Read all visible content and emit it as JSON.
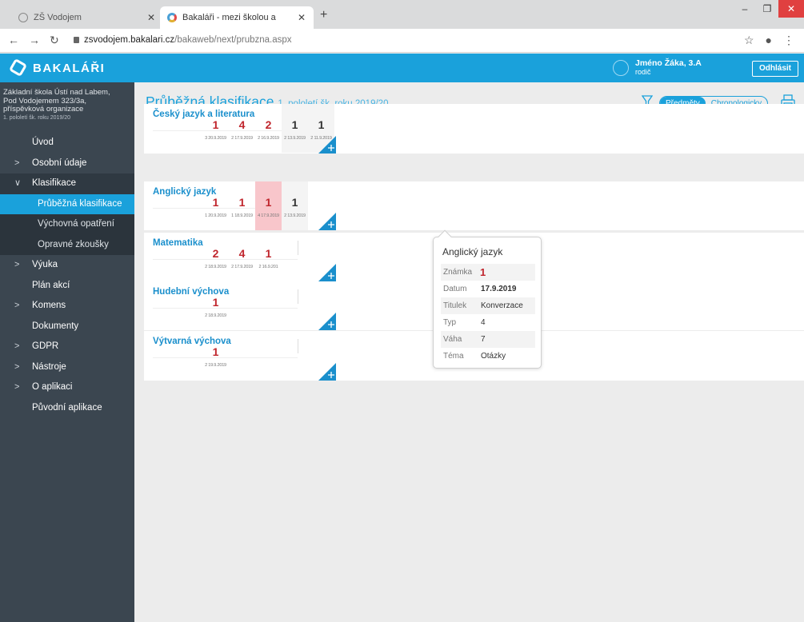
{
  "browser": {
    "tabs": [
      {
        "title": "ZŠ Vodojem",
        "active": false
      },
      {
        "title": "Bakaláři - mezi školou a rodinou",
        "active": true
      }
    ],
    "url_domain": "zsvodojem.bakalari.cz",
    "url_path": "/bakaweb/next/prubzna.aspx"
  },
  "header": {
    "logo": "BAKALÁŘI",
    "user_name": "Jméno Žáka, 3.A",
    "user_role": "rodič",
    "logout": "Odhlásit",
    "accent": "#1aa1db"
  },
  "sidebar": {
    "school_lines": [
      "Základní škola Ústí nad Labem,",
      "Pod Vodojemem 323/3a,",
      "příspěvková organizace"
    ],
    "period": "1. pololetí šk. roku 2019/20",
    "items": [
      {
        "label": "Úvod",
        "chev": ""
      },
      {
        "label": "Osobní údaje",
        "chev": ">"
      },
      {
        "label": "Klasifikace",
        "chev": "∨"
      },
      {
        "label": "Průběžná klasifikace",
        "chev": "",
        "sub": true,
        "active": true
      },
      {
        "label": "Výchovná opatření",
        "chev": "",
        "sub": true
      },
      {
        "label": "Opravné zkoušky",
        "chev": "",
        "sub": true
      },
      {
        "label": "Výuka",
        "chev": ">"
      },
      {
        "label": "Plán akcí",
        "chev": ""
      },
      {
        "label": "Komens",
        "chev": ">"
      },
      {
        "label": "Dokumenty",
        "chev": ""
      },
      {
        "label": "GDPR",
        "chev": ">"
      },
      {
        "label": "Nástroje",
        "chev": ">"
      },
      {
        "label": "O aplikaci",
        "chev": ">"
      },
      {
        "label": "Původní aplikace",
        "chev": ""
      }
    ]
  },
  "main": {
    "title": "Průběžná klasifikace",
    "subtitle": "1. pololetí šk. roku 2019/20",
    "view_buttons": {
      "subjects": "Předměty",
      "chronological": "Chronologicky"
    },
    "subjects": [
      {
        "name": "Český jazyk a literatura",
        "grades": [
          {
            "value": "1",
            "date": "3 20.9.2019",
            "color": "red"
          },
          {
            "value": "4",
            "date": "2 17.9.2019",
            "color": "red"
          },
          {
            "value": "2",
            "date": "2 16.9.2019",
            "color": "red"
          },
          {
            "value": "1",
            "date": "2 13.9.2019",
            "color": "dark"
          },
          {
            "value": "1",
            "date": "2 11.9.2019",
            "color": "dark"
          }
        ]
      },
      {
        "name": "Anglický jazyk",
        "grades": [
          {
            "value": "1",
            "date": "1 20.9.2019",
            "color": "red"
          },
          {
            "value": "1",
            "date": "1 18.9.2019",
            "color": "red"
          },
          {
            "value": "1",
            "date": "4 17.9.2019",
            "color": "red",
            "highlight": true
          },
          {
            "value": "1",
            "date": "2 13.9.2019",
            "color": "dark"
          }
        ]
      },
      {
        "name": "Matematika",
        "grades": [
          {
            "value": "2",
            "date": "2 18.9.2019",
            "color": "red"
          },
          {
            "value": "4",
            "date": "2 17.9.2019",
            "color": "red"
          },
          {
            "value": "1",
            "date": "2 16.9.201",
            "color": "red"
          }
        ]
      },
      {
        "name": "Hudební výchova",
        "grades": [
          {
            "value": "1",
            "date": "2 18.9.2019",
            "color": "red"
          }
        ]
      },
      {
        "name": "Výtvarná výchova",
        "grades": [
          {
            "value": "1",
            "date": "2 19.9.2019",
            "color": "red"
          }
        ]
      }
    ]
  },
  "tooltip": {
    "title": "Anglický jazyk",
    "rows": [
      {
        "key": "Známka",
        "value": "1"
      },
      {
        "key": "Datum",
        "value": "17.9.2019"
      },
      {
        "key": "Titulek",
        "value": "Konverzace"
      },
      {
        "key": "Typ",
        "value": "4"
      },
      {
        "key": "Váha",
        "value": "7"
      },
      {
        "key": "Téma",
        "value": "Otázky"
      }
    ]
  }
}
